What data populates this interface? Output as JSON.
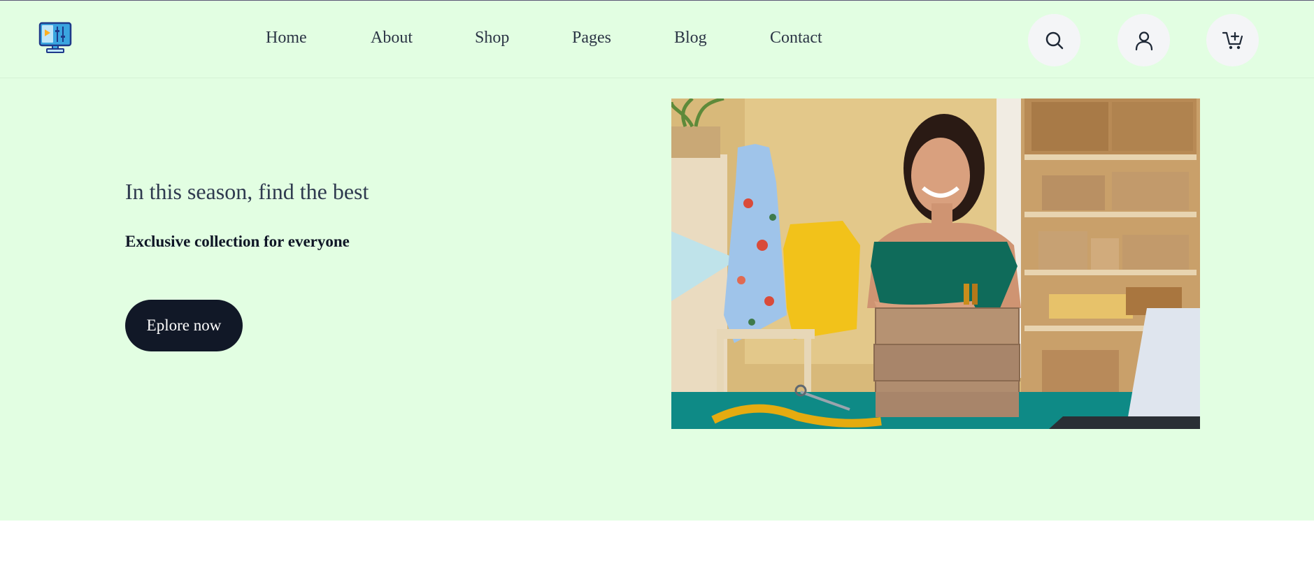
{
  "header": {
    "logo_icon": "monitor-dashboard-icon",
    "nav": [
      {
        "label": "Home"
      },
      {
        "label": "About"
      },
      {
        "label": "Shop"
      },
      {
        "label": "Pages"
      },
      {
        "label": "Blog"
      },
      {
        "label": "Contact"
      }
    ],
    "actions": [
      {
        "icon": "search-icon"
      },
      {
        "icon": "user-icon"
      },
      {
        "icon": "cart-add-icon"
      }
    ]
  },
  "hero": {
    "title": "In this season, find the best",
    "subtitle": "Exclusive collection for everyone",
    "cta_label": "Eplore now",
    "image": "shop-owner-with-parcels-photo"
  },
  "colors": {
    "page_bg": "#e2fee2",
    "cta_bg": "#111827",
    "icon_button_bg": "#f4f5f7",
    "nav_text": "#2b3545"
  }
}
